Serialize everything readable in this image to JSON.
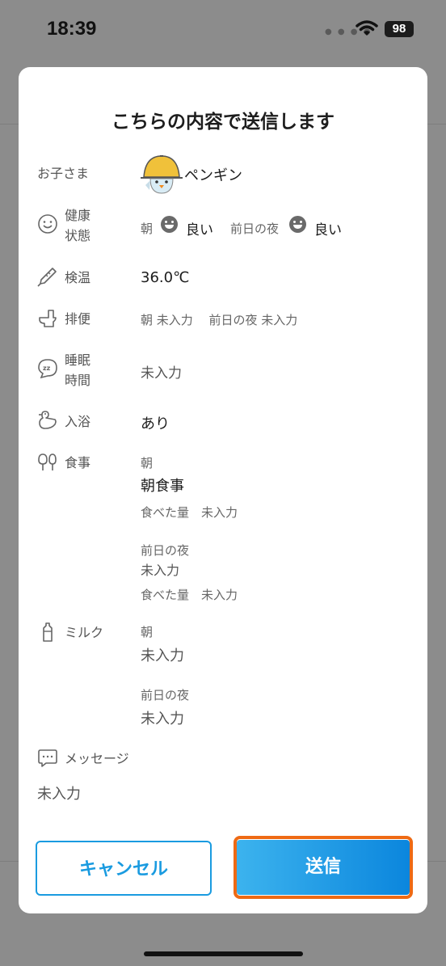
{
  "status_bar": {
    "time": "18:39",
    "battery": "98"
  },
  "modal": {
    "title": "こちらの内容で送信します",
    "child": {
      "label": "お子さま",
      "name": "ペンギン"
    },
    "health": {
      "label": "健康\n状態",
      "morning_label": "朝",
      "morning_value": "良い",
      "prev_night_label": "前日の夜",
      "prev_night_value": "良い"
    },
    "temperature": {
      "label": "検温",
      "value": "36.0℃"
    },
    "bowel": {
      "label": "排便",
      "text": "朝 未入力　 前日の夜 未入力"
    },
    "sleep": {
      "label": "睡眠\n時間",
      "value": "未入力"
    },
    "bath": {
      "label": "入浴",
      "value": "あり"
    },
    "meal": {
      "label": "食事",
      "morning_label": "朝",
      "morning_value": "朝食事",
      "morning_amount": "食べた量　未入力",
      "prev_night_label": "前日の夜",
      "prev_night_value": "未入力",
      "prev_night_amount": "食べた量　未入力"
    },
    "milk": {
      "label": "ミルク",
      "morning_label": "朝",
      "morning_value": "未入力",
      "prev_night_label": "前日の夜",
      "prev_night_value": "未入力"
    },
    "message": {
      "label": "メッセージ",
      "value": "未入力"
    },
    "buttons": {
      "cancel": "キャンセル",
      "send": "送信"
    }
  },
  "icons": [
    "smile-icon",
    "thermometer-icon",
    "toilet-icon",
    "sleep-icon",
    "duck-icon",
    "meal-icon",
    "bottle-icon",
    "message-icon",
    "wifi-icon",
    "battery-icon"
  ]
}
